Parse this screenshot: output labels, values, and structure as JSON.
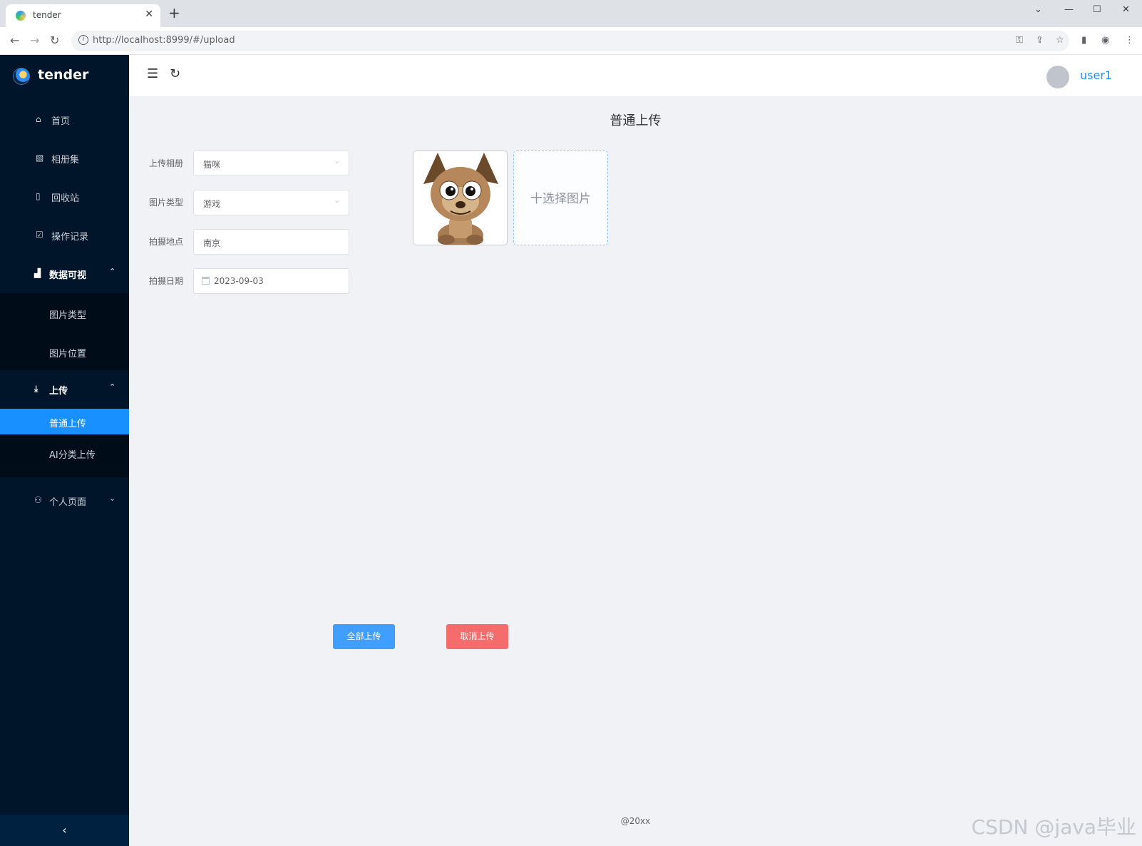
{
  "browser": {
    "tab_title": "tender",
    "tab_close": "✕",
    "new_tab": "+",
    "url_host": "http://localhost",
    "url_rest": ":8999/#/upload"
  },
  "sidebar": {
    "brand": "tender",
    "items": [
      {
        "label": "首页",
        "icon": "home-icon"
      },
      {
        "label": "相册集",
        "icon": "picture-icon"
      },
      {
        "label": "回收站",
        "icon": "trash-icon"
      },
      {
        "label": "操作记录",
        "icon": "checklist-icon"
      }
    ],
    "group_viz": {
      "label": "数据可视",
      "icon": "chart-icon",
      "children": [
        "图片类型",
        "图片位置"
      ]
    },
    "group_upload": {
      "label": "上传",
      "icon": "upload-icon",
      "children": [
        "普通上传",
        "AI分类上传"
      ],
      "active": "普通上传"
    },
    "personal": {
      "label": "个人页面",
      "icon": "user-icon"
    },
    "collapse": "‹"
  },
  "header": {
    "username": "user1"
  },
  "main": {
    "title": "普通上传",
    "form": {
      "album_label": "上传相册",
      "album_value": "猫咪",
      "type_label": "图片类型",
      "type_value": "游戏",
      "location_label": "拍摄地点",
      "location_value": "南京",
      "date_label": "拍摄日期",
      "date_value": "2023-09-03"
    },
    "picker_label": "十选择图片",
    "upload_all": "全部上传",
    "cancel_upload": "取消上传",
    "footer": "@20xx",
    "watermark": "CSDN @java毕业"
  },
  "colors": {
    "sidebar_bg": "#001529",
    "accent": "#1890ff",
    "primary_button": "#409eff",
    "danger_button": "#f56c6c"
  }
}
